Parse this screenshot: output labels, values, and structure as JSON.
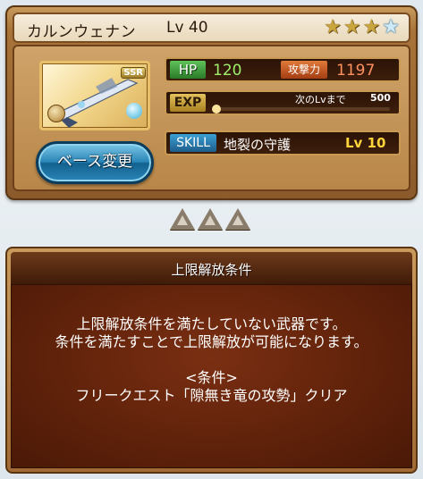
{
  "weapon": {
    "name": "カルンウェナン",
    "level_label": "Lv 40",
    "rarity_badge": "SSR",
    "stars_filled": 3,
    "stars_total": 4
  },
  "stats": {
    "hp_label": "HP",
    "hp_value": "120",
    "atk_label": "攻撃力",
    "atk_value": "1197",
    "exp_label": "EXP",
    "exp_fraction": 0.0,
    "next_label": "次のLvまで",
    "next_value": "500"
  },
  "skill": {
    "label": "SKILL",
    "name": "地裂の守護",
    "level": "Lv 10"
  },
  "base_change_button": "ベース変更",
  "uncap_count": 3,
  "conditions": {
    "title": "上限解放条件",
    "line1": "上限解放条件を満たしていない武器です。",
    "line2": "条件を満たすことで上限解放が可能になります。",
    "condition_header": "<条件>",
    "condition_text": "フリークエスト「隙無き竜の攻勢」クリア"
  },
  "colors": {
    "hp_value": "#9ef06b",
    "atk_value": "#ff9160",
    "skill_level": "#ffd43b",
    "button_blue": "#2a86b8"
  }
}
